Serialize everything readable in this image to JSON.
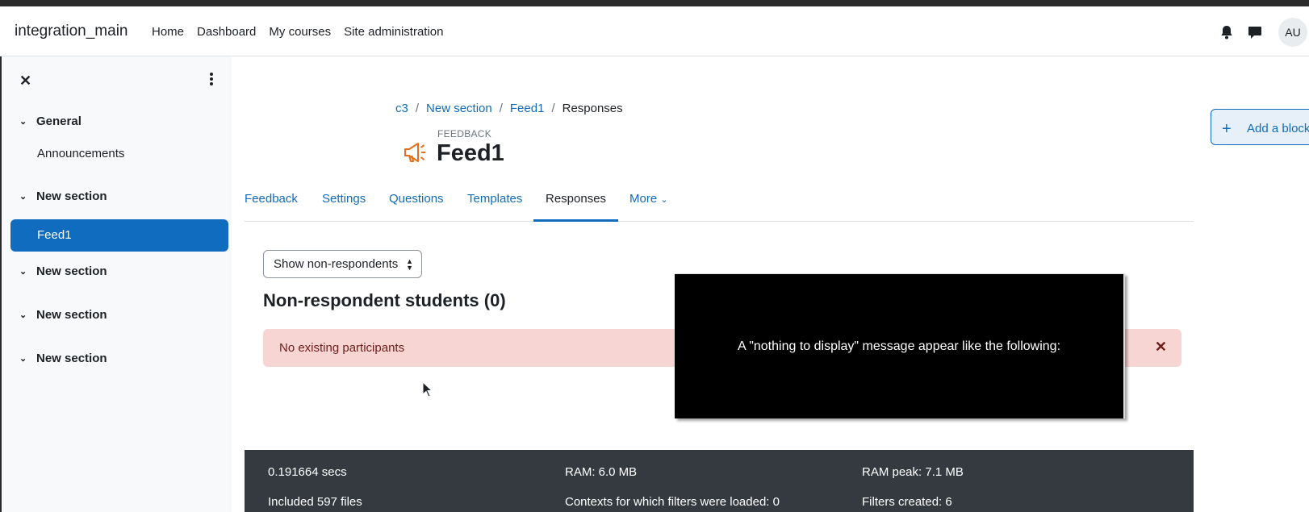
{
  "navbar": {
    "brand": "integration_main",
    "links": [
      "Home",
      "Dashboard",
      "My courses",
      "Site administration"
    ],
    "avatar_initials": "AU",
    "icons": [
      "bell-icon",
      "chat-icon"
    ]
  },
  "drawer": {
    "close_glyph": "✕",
    "sections": [
      {
        "label": "General",
        "items": [
          "Announcements"
        ]
      },
      {
        "label": "New section",
        "items": [
          "Feed1"
        ]
      },
      {
        "label": "New section",
        "items": []
      },
      {
        "label": "New section",
        "items": []
      },
      {
        "label": "New section",
        "items": []
      }
    ],
    "active_item": "Feed1"
  },
  "breadcrumb": {
    "items": [
      "c3",
      "New section",
      "Feed1"
    ],
    "current": "Responses",
    "separator": "/"
  },
  "header": {
    "module_type": "FEEDBACK",
    "title": "Feed1"
  },
  "tabs": {
    "items": [
      "Feedback",
      "Settings",
      "Questions",
      "Templates",
      "Responses",
      "More"
    ],
    "active": "Responses"
  },
  "content": {
    "select_value": "Show non-respondents",
    "heading": "Non-respondent students (0)",
    "alert_text": "No existing participants",
    "alert_close": "✕"
  },
  "tooltip": {
    "text": "A \"nothing to display\" message appear like the following:"
  },
  "footer": {
    "time": "0.191664 secs",
    "ram": "RAM: 6.0 MB",
    "ram_peak": "RAM peak: 7.1 MB",
    "files": "Included 597 files",
    "contexts": "Contexts for which filters were loaded: 0",
    "filters": "Filters created: 6"
  },
  "blocks": {
    "add_label": "Add a block",
    "add_glyph": "+"
  },
  "colors": {
    "primary": "#0f6cbf",
    "alert_bg": "#f6d5d3",
    "footer_bg": "#343a40",
    "module_icon": "#e86c19"
  }
}
